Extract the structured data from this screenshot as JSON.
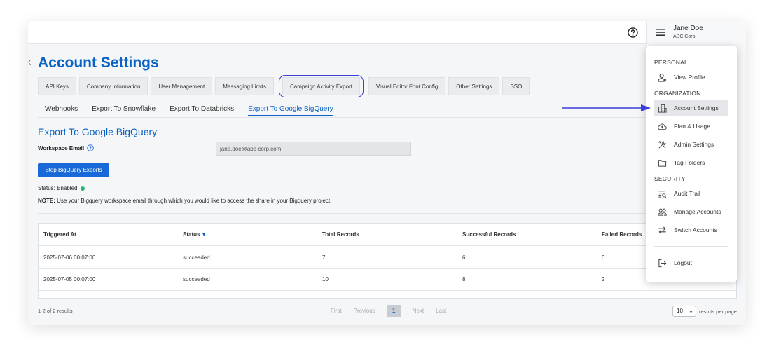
{
  "header": {
    "user_name": "Jane Doe",
    "company": "ABC Corp",
    "help_icon": "help-circle-icon",
    "menu_icon": "hamburger-menu-icon"
  },
  "page": {
    "title": "Account Settings",
    "tabs": [
      "API Keys",
      "Company Information",
      "User Management",
      "Messaging Limits",
      "Campaign Activity Export",
      "Visual Editor Font Config",
      "Other Settings",
      "SSO"
    ],
    "highlighted_tab": "Campaign Activity Export",
    "subtabs": [
      "Webhooks",
      "Export To Snowflake",
      "Export To Databricks",
      "Export To Google BigQuery"
    ],
    "active_subtab": "Export To Google BigQuery"
  },
  "export": {
    "section_title": "Export To Google BigQuery",
    "workspace_label": "Workspace Email",
    "workspace_email": "jane.doe@abc-corp.com",
    "stop_button": "Stop BigQuery Exports",
    "status_label": "Status: Enabled",
    "status_color": "#2bb673",
    "note_label": "NOTE:",
    "note_text": " Use your Bigquery workspace email through which you would like to access the share in your Bigquery project."
  },
  "table": {
    "columns": [
      "Triggered At",
      "Status",
      "Total Records",
      "Successful Records",
      "Failed Records"
    ],
    "sort_indicator": "▼",
    "rows": [
      [
        "2025-07-06 00:07:00",
        "succeeded",
        "7",
        "6",
        "0"
      ],
      [
        "2025-07-05 00:07:00",
        "succeeded",
        "10",
        "8",
        "2"
      ]
    ]
  },
  "pagination": {
    "results_count": "1-2 of 2 results",
    "first": "First",
    "previous": "Previous",
    "current_page": "1",
    "next": "Next",
    "last": "Last",
    "per_page_value": "10",
    "per_page_label": "results per page"
  },
  "menu": {
    "personal_heading": "PERSONAL",
    "view_profile": "View Profile",
    "organization_heading": "ORGANIZATION",
    "account_settings": "Account Settings",
    "plan_usage": "Plan & Usage",
    "admin_settings": "Admin Settings",
    "tag_folders": "Tag Folders",
    "security_heading": "SECURITY",
    "audit_trail": "Audit Trail",
    "manage_accounts": "Manage Accounts",
    "switch_accounts": "Switch Accounts",
    "logout": "Logout"
  },
  "colors": {
    "brand_blue": "#0b63c5",
    "button_blue": "#1769d8",
    "annotation_arrow": "#3c3fd6"
  }
}
